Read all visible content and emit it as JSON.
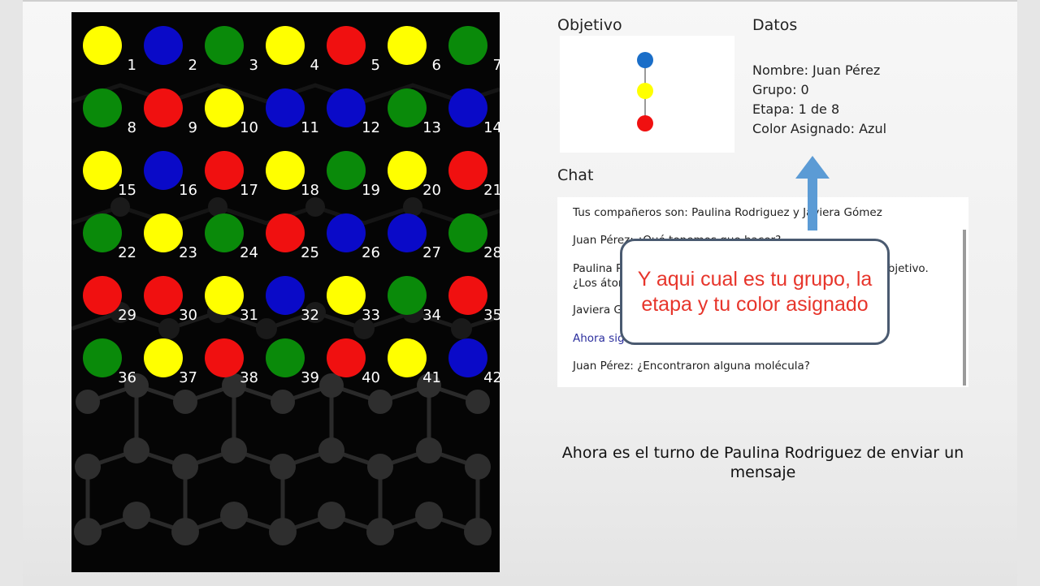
{
  "board": {
    "palette": {
      "yellow": "#ffff00",
      "blue": "#0a0ac8",
      "green": "#0a8a0a",
      "red": "#f01010"
    },
    "cells": [
      {
        "n": "1",
        "c": "yellow"
      },
      {
        "n": "2",
        "c": "blue"
      },
      {
        "n": "3",
        "c": "green"
      },
      {
        "n": "4",
        "c": "yellow"
      },
      {
        "n": "5",
        "c": "red"
      },
      {
        "n": "6",
        "c": "yellow"
      },
      {
        "n": "7",
        "c": "green"
      },
      {
        "n": "8",
        "c": "green"
      },
      {
        "n": "9",
        "c": "red"
      },
      {
        "n": "10",
        "c": "yellow"
      },
      {
        "n": "11",
        "c": "blue"
      },
      {
        "n": "12",
        "c": "blue"
      },
      {
        "n": "13",
        "c": "green"
      },
      {
        "n": "14",
        "c": "blue"
      },
      {
        "n": "15",
        "c": "yellow"
      },
      {
        "n": "16",
        "c": "blue"
      },
      {
        "n": "17",
        "c": "red"
      },
      {
        "n": "18",
        "c": "yellow"
      },
      {
        "n": "19",
        "c": "green"
      },
      {
        "n": "20",
        "c": "yellow"
      },
      {
        "n": "21",
        "c": "red"
      },
      {
        "n": "22",
        "c": "green"
      },
      {
        "n": "23",
        "c": "yellow"
      },
      {
        "n": "24",
        "c": "green"
      },
      {
        "n": "25",
        "c": "red"
      },
      {
        "n": "26",
        "c": "blue"
      },
      {
        "n": "27",
        "c": "blue"
      },
      {
        "n": "28",
        "c": "green"
      },
      {
        "n": "29",
        "c": "red"
      },
      {
        "n": "30",
        "c": "red"
      },
      {
        "n": "31",
        "c": "yellow"
      },
      {
        "n": "32",
        "c": "blue"
      },
      {
        "n": "33",
        "c": "yellow"
      },
      {
        "n": "34",
        "c": "green"
      },
      {
        "n": "35",
        "c": "red"
      },
      {
        "n": "36",
        "c": "green"
      },
      {
        "n": "37",
        "c": "yellow"
      },
      {
        "n": "38",
        "c": "red"
      },
      {
        "n": "39",
        "c": "green"
      },
      {
        "n": "40",
        "c": "red"
      },
      {
        "n": "41",
        "c": "yellow"
      },
      {
        "n": "42",
        "c": "blue"
      }
    ]
  },
  "objetivo": {
    "title": "Objetivo",
    "molecule": [
      {
        "color": "#1a6ec8"
      },
      {
        "color": "#ffff00"
      },
      {
        "color": "#f01010"
      }
    ]
  },
  "datos": {
    "title": "Datos",
    "nombre": "Nombre: Juan Pérez",
    "grupo": "Grupo: 0",
    "etapa": "Etapa: 1 de 8",
    "color": "Color Asignado: Azul"
  },
  "chat": {
    "title": "Chat",
    "messages": [
      {
        "text": "Tus compañeros son: Paulina Rodriguez y Javiera Gómez"
      },
      {
        "text": "Juan Pérez: ¿Qué tenemos que hacer?"
      },
      {
        "text": "Paulina Rodriguez: Tenemos que buscar la molécula del objetivo. ¿Los átomos ¿están de la misma forma?"
      },
      {
        "text": "Javiera Gómez: Sí"
      },
      {
        "text": "Ahora sigue el turno de Paulina Rodriguez"
      },
      {
        "text": "Juan Pérez: ¿Encontraron alguna molécula?"
      }
    ]
  },
  "turn_message": "Ahora es el turno de Paulina Rodriguez de enviar un mensaje",
  "callout": {
    "text": "Y aqui cual es tu grupo, la etapa y tu color asignado",
    "arrow_color": "#5b9bd5"
  }
}
